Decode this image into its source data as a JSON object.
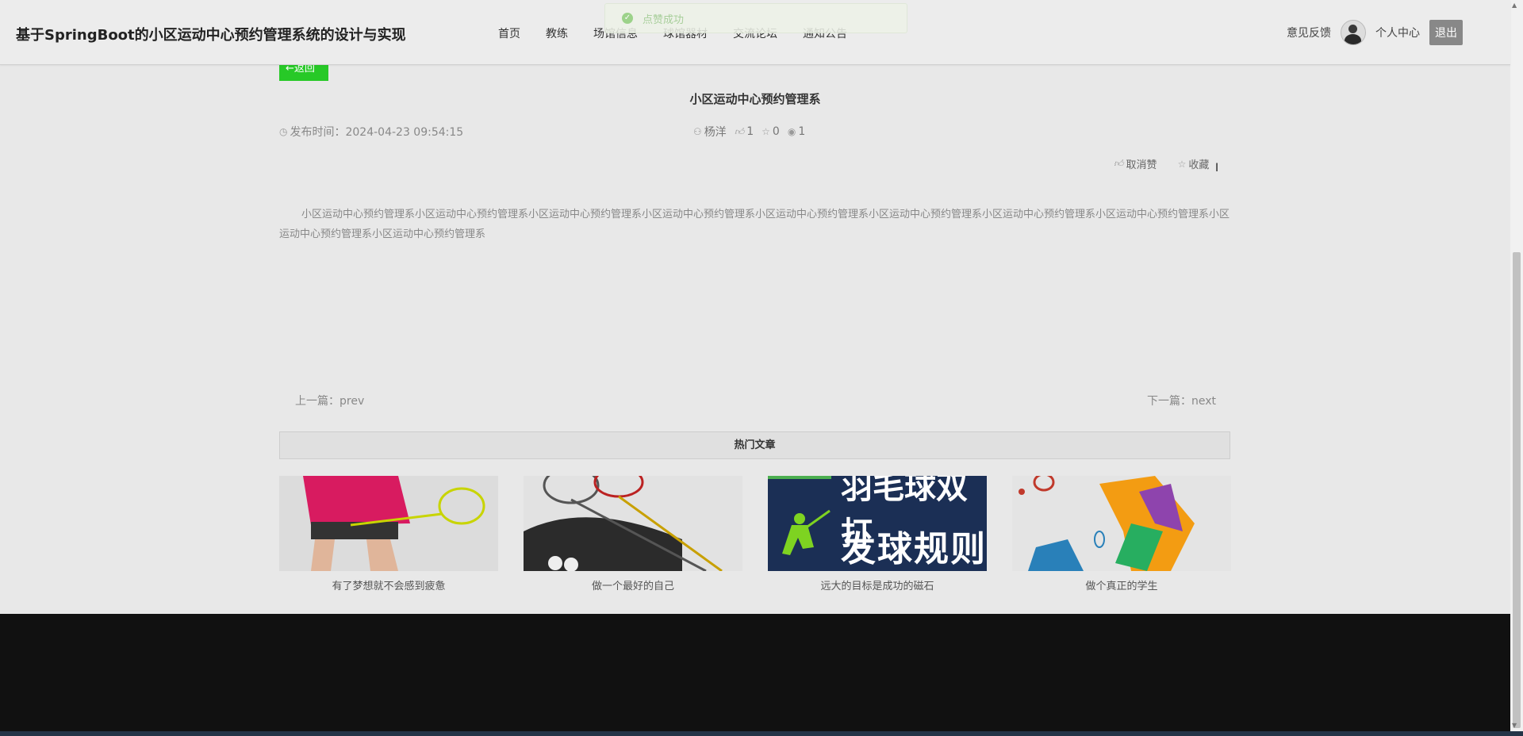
{
  "header": {
    "site_title": "基于SpringBoot的小区运动中心预约管理系统的设计与实现",
    "nav": [
      "首页",
      "教练",
      "场馆信息",
      "球馆器材",
      "交流论坛",
      "通知公告"
    ],
    "feedback": "意见反馈",
    "user_center": "个人中心",
    "logout": "退出"
  },
  "toast": {
    "message": "点赞成功"
  },
  "article": {
    "back_label": "←返回",
    "title": "小区运动中心预约管理系",
    "publish_label": "发布时间：2024-04-23 09:54:15",
    "author": "杨洋",
    "likes": "1",
    "favorites": "0",
    "views": "1",
    "unlike_label": "取消赞",
    "favorite_label": "收藏",
    "body": "小区运动中心预约管理系小区运动中心预约管理系小区运动中心预约管理系小区运动中心预约管理系小区运动中心预约管理系小区运动中心预约管理系小区运动中心预约管理系小区运动中心预约管理系小区运动中心预约管理系小区运动中心预约管理系",
    "prev": "上一篇：prev",
    "next": "下一篇：next"
  },
  "hot": {
    "heading": "热门文章",
    "cards": [
      {
        "caption": "有了梦想就不会感到疲惫"
      },
      {
        "caption": "做一个最好的自己"
      },
      {
        "caption": "远大的目标是成功的磁石",
        "image_text_top": "羽毛球双打",
        "image_text": "发球规则"
      },
      {
        "caption": "做个真正的学生"
      }
    ]
  },
  "colors": {
    "accent": "#27c927",
    "footer": "#111111"
  }
}
